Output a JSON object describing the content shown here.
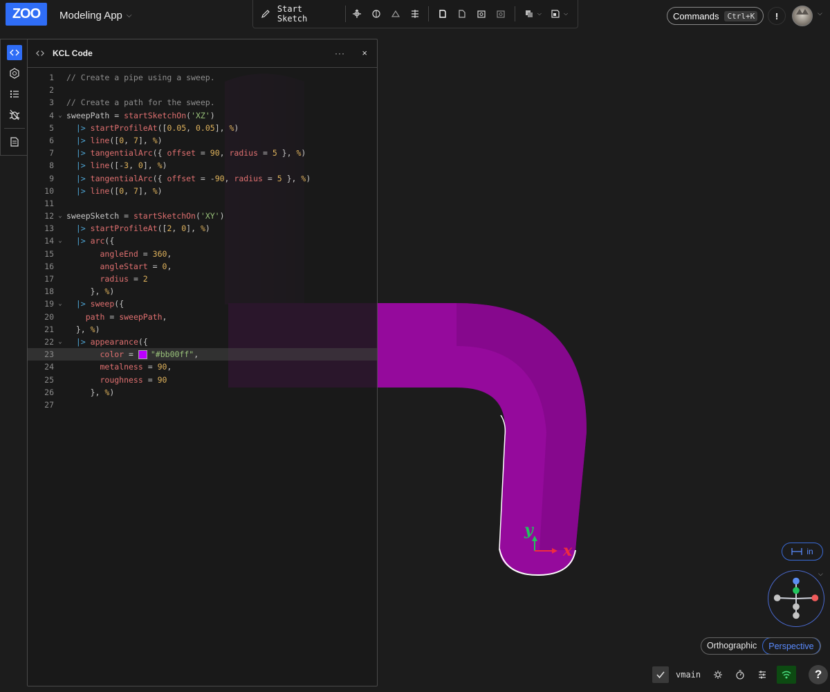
{
  "header": {
    "logo_text": "ZOO",
    "app_name": "Modeling App",
    "start_sketch_label": "Start Sketch",
    "commands_label": "Commands",
    "commands_shortcut": "Ctrl+K",
    "alert_label": "!"
  },
  "panel": {
    "title": "KCL Code",
    "menu_label": "···",
    "close_label": "×"
  },
  "viewport": {
    "model_color": "#bb00ff",
    "axis_x_label": "x",
    "axis_y_label": "y",
    "units_label": "in",
    "projection_options": [
      "Orthographic",
      "Perspective"
    ],
    "projection_selected": "Perspective"
  },
  "status": {
    "branch": "vmain",
    "help_label": "?"
  },
  "code_lines": [
    {
      "n": "1",
      "fold": "",
      "tokens": [
        [
          "cm",
          "// Create a pipe using a sweep."
        ]
      ]
    },
    {
      "n": "2",
      "fold": "",
      "tokens": []
    },
    {
      "n": "3",
      "fold": "",
      "tokens": [
        [
          "cm",
          "// Create a path for the sweep."
        ]
      ]
    },
    {
      "n": "4",
      "fold": "v",
      "tokens": [
        [
          "src",
          "sweepPath "
        ],
        [
          "src",
          "= "
        ],
        [
          "fn",
          "startSketchOn"
        ],
        [
          "src",
          "("
        ],
        [
          "str",
          "'XZ'"
        ],
        [
          "src",
          ")"
        ]
      ]
    },
    {
      "n": "5",
      "fold": "",
      "tokens": [
        [
          "src",
          "  "
        ],
        [
          "pipe",
          "|> "
        ],
        [
          "fn",
          "startProfileAt"
        ],
        [
          "src",
          "(["
        ],
        [
          "num",
          "0.05"
        ],
        [
          "src",
          ", "
        ],
        [
          "num",
          "0.05"
        ],
        [
          "src",
          "], "
        ],
        [
          "pct",
          "%"
        ],
        [
          "src",
          ")"
        ]
      ]
    },
    {
      "n": "6",
      "fold": "",
      "tokens": [
        [
          "src",
          "  "
        ],
        [
          "pipe",
          "|> "
        ],
        [
          "fn",
          "line"
        ],
        [
          "src",
          "(["
        ],
        [
          "num",
          "0"
        ],
        [
          "src",
          ", "
        ],
        [
          "num",
          "7"
        ],
        [
          "src",
          "], "
        ],
        [
          "pct",
          "%"
        ],
        [
          "src",
          ")"
        ]
      ]
    },
    {
      "n": "7",
      "fold": "",
      "tokens": [
        [
          "src",
          "  "
        ],
        [
          "pipe",
          "|> "
        ],
        [
          "fn",
          "tangentialArc"
        ],
        [
          "src",
          "({ "
        ],
        [
          "fn",
          "offset"
        ],
        [
          "src",
          " = "
        ],
        [
          "num",
          "90"
        ],
        [
          "src",
          ", "
        ],
        [
          "fn",
          "radius"
        ],
        [
          "src",
          " = "
        ],
        [
          "num",
          "5"
        ],
        [
          "src",
          " }, "
        ],
        [
          "pct",
          "%"
        ],
        [
          "src",
          ")"
        ]
      ]
    },
    {
      "n": "8",
      "fold": "",
      "tokens": [
        [
          "src",
          "  "
        ],
        [
          "pipe",
          "|> "
        ],
        [
          "fn",
          "line"
        ],
        [
          "src",
          "([-"
        ],
        [
          "num",
          "3"
        ],
        [
          "src",
          ", "
        ],
        [
          "num",
          "0"
        ],
        [
          "src",
          "], "
        ],
        [
          "pct",
          "%"
        ],
        [
          "src",
          ")"
        ]
      ]
    },
    {
      "n": "9",
      "fold": "",
      "tokens": [
        [
          "src",
          "  "
        ],
        [
          "pipe",
          "|> "
        ],
        [
          "fn",
          "tangentialArc"
        ],
        [
          "src",
          "({ "
        ],
        [
          "fn",
          "offset"
        ],
        [
          "src",
          " = -"
        ],
        [
          "num",
          "90"
        ],
        [
          "src",
          ", "
        ],
        [
          "fn",
          "radius"
        ],
        [
          "src",
          " = "
        ],
        [
          "num",
          "5"
        ],
        [
          "src",
          " }, "
        ],
        [
          "pct",
          "%"
        ],
        [
          "src",
          ")"
        ]
      ]
    },
    {
      "n": "10",
      "fold": "",
      "tokens": [
        [
          "src",
          "  "
        ],
        [
          "pipe",
          "|> "
        ],
        [
          "fn",
          "line"
        ],
        [
          "src",
          "(["
        ],
        [
          "num",
          "0"
        ],
        [
          "src",
          ", "
        ],
        [
          "num",
          "7"
        ],
        [
          "src",
          "], "
        ],
        [
          "pct",
          "%"
        ],
        [
          "src",
          ")"
        ]
      ]
    },
    {
      "n": "11",
      "fold": "",
      "tokens": []
    },
    {
      "n": "12",
      "fold": "v",
      "tokens": [
        [
          "src",
          "sweepSketch "
        ],
        [
          "src",
          "= "
        ],
        [
          "fn",
          "startSketchOn"
        ],
        [
          "src",
          "("
        ],
        [
          "str",
          "'XY'"
        ],
        [
          "src",
          ")"
        ]
      ]
    },
    {
      "n": "13",
      "fold": "",
      "tokens": [
        [
          "src",
          "  "
        ],
        [
          "pipe",
          "|> "
        ],
        [
          "fn",
          "startProfileAt"
        ],
        [
          "src",
          "(["
        ],
        [
          "num",
          "2"
        ],
        [
          "src",
          ", "
        ],
        [
          "num",
          "0"
        ],
        [
          "src",
          "], "
        ],
        [
          "pct",
          "%"
        ],
        [
          "src",
          ")"
        ]
      ]
    },
    {
      "n": "14",
      "fold": "v",
      "tokens": [
        [
          "src",
          "  "
        ],
        [
          "pipe",
          "|> "
        ],
        [
          "fn",
          "arc"
        ],
        [
          "src",
          "({"
        ]
      ]
    },
    {
      "n": "15",
      "fold": "",
      "tokens": [
        [
          "src",
          "       "
        ],
        [
          "fn",
          "angleEnd"
        ],
        [
          "src",
          " = "
        ],
        [
          "num",
          "360"
        ],
        [
          "src",
          ","
        ]
      ]
    },
    {
      "n": "16",
      "fold": "",
      "tokens": [
        [
          "src",
          "       "
        ],
        [
          "fn",
          "angleStart"
        ],
        [
          "src",
          " = "
        ],
        [
          "num",
          "0"
        ],
        [
          "src",
          ","
        ]
      ]
    },
    {
      "n": "17",
      "fold": "",
      "tokens": [
        [
          "src",
          "       "
        ],
        [
          "fn",
          "radius"
        ],
        [
          "src",
          " = "
        ],
        [
          "num",
          "2"
        ]
      ]
    },
    {
      "n": "18",
      "fold": "",
      "tokens": [
        [
          "src",
          "     }, "
        ],
        [
          "pct",
          "%"
        ],
        [
          "src",
          ")"
        ]
      ]
    },
    {
      "n": "19",
      "fold": "v",
      "tokens": [
        [
          "src",
          "  "
        ],
        [
          "pipe",
          "|> "
        ],
        [
          "fn",
          "sweep"
        ],
        [
          "src",
          "({"
        ]
      ]
    },
    {
      "n": "20",
      "fold": "",
      "tokens": [
        [
          "src",
          "    "
        ],
        [
          "fn",
          "path"
        ],
        [
          "src",
          " = "
        ],
        [
          "fn",
          "sweepPath"
        ],
        [
          "src",
          ","
        ]
      ]
    },
    {
      "n": "21",
      "fold": "",
      "tokens": [
        [
          "src",
          "  }, "
        ],
        [
          "pct",
          "%"
        ],
        [
          "src",
          ")"
        ]
      ]
    },
    {
      "n": "22",
      "fold": "v",
      "tokens": [
        [
          "src",
          "  "
        ],
        [
          "pipe",
          "|> "
        ],
        [
          "fn",
          "appearance"
        ],
        [
          "src",
          "({"
        ]
      ]
    },
    {
      "n": "23",
      "fold": "",
      "active": true,
      "swatch": true,
      "tokens": [
        [
          "src",
          "       "
        ],
        [
          "fn",
          "color"
        ],
        [
          "src",
          " = "
        ],
        [
          "swatch",
          ""
        ],
        [
          "str",
          "\"#bb00ff\""
        ],
        [
          "src",
          ","
        ]
      ]
    },
    {
      "n": "24",
      "fold": "",
      "tokens": [
        [
          "src",
          "       "
        ],
        [
          "fn",
          "metalness"
        ],
        [
          "src",
          " = "
        ],
        [
          "num",
          "90"
        ],
        [
          "src",
          ","
        ]
      ]
    },
    {
      "n": "25",
      "fold": "",
      "tokens": [
        [
          "src",
          "       "
        ],
        [
          "fn",
          "roughness"
        ],
        [
          "src",
          " = "
        ],
        [
          "num",
          "90"
        ]
      ]
    },
    {
      "n": "26",
      "fold": "",
      "tokens": [
        [
          "src",
          "     }, "
        ],
        [
          "pct",
          "%"
        ],
        [
          "src",
          ")"
        ]
      ]
    },
    {
      "n": "27",
      "fold": "",
      "tokens": []
    }
  ]
}
